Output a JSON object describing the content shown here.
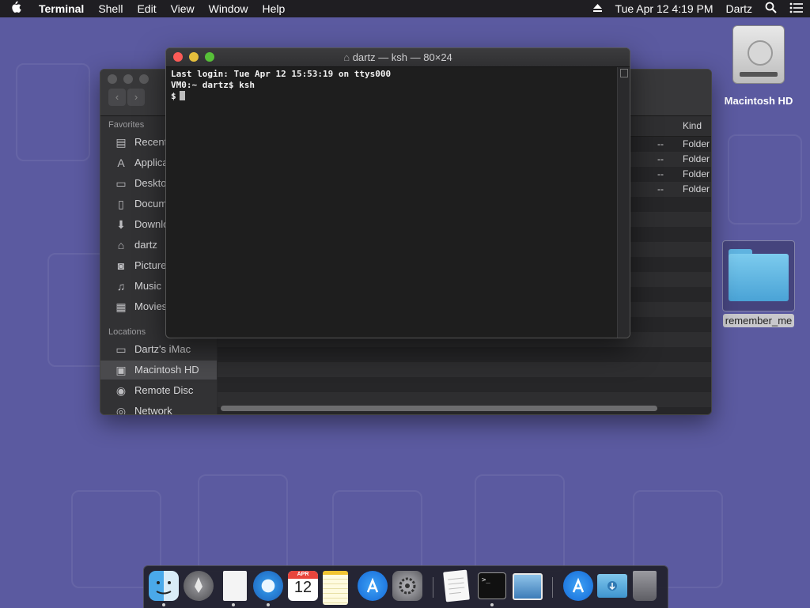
{
  "menubar": {
    "apple_glyph": "",
    "app_name": "Terminal",
    "menus": [
      "Shell",
      "Edit",
      "View",
      "Window",
      "Help"
    ],
    "date_time": "Tue Apr 12  4:19 PM",
    "user": "Dartz"
  },
  "desktop": {
    "hd_label": "Macintosh HD",
    "folder_label": "remember_me"
  },
  "finder": {
    "favorites_heading": "Favorites",
    "favorites": [
      "Recent",
      "Applica",
      "Desktop",
      "Docum",
      "Downlo",
      "dartz",
      "Picture",
      "Music",
      "Movies"
    ],
    "locations_heading": "Locations",
    "locations": [
      "Dartz's iMac",
      "Macintosh HD",
      "Remote Disc",
      "Network"
    ],
    "column_kind": "Kind",
    "rows": [
      {
        "size": "--",
        "kind": "Folder"
      },
      {
        "size": "--",
        "kind": "Folder"
      },
      {
        "size": "--",
        "kind": "Folder"
      },
      {
        "size": "--",
        "kind": "Folder"
      }
    ]
  },
  "terminal": {
    "title": "dartz — ksh — 80×24",
    "lines": [
      "Last login: Tue Apr 12 15:53:19 on ttys000",
      "VM0:~ dartz$ ksh",
      "$"
    ]
  },
  "dock": {
    "calendar_month": "APR",
    "calendar_day": "12",
    "terminal_prompt": ">_"
  }
}
